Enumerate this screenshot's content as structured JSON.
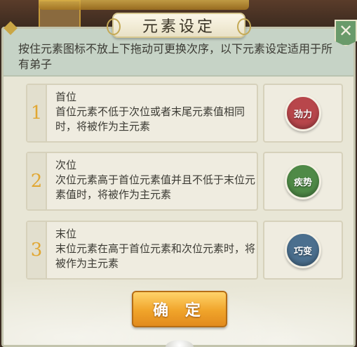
{
  "dialog": {
    "title": "元素设定",
    "description": "按住元素图标不放上下拖动可更换次序，以下元素设定适用于所有弟子",
    "close_icon": "close-icon",
    "confirm_label": "确 定"
  },
  "rows": [
    {
      "number": "1",
      "title": "首位",
      "desc": "首位元素不低于次位或者末尾元素值相同时，将被作为主元素",
      "element": {
        "label": "劲力",
        "color": "#b8464b",
        "icon": "element-jinli-icon"
      }
    },
    {
      "number": "2",
      "title": "次位",
      "desc": "次位元素高于首位元素值并且不低于末位元素值时，将被作为主元素",
      "element": {
        "label": "疾势",
        "color": "#4f8a47",
        "icon": "element-jishi-icon"
      }
    },
    {
      "number": "3",
      "title": "末位",
      "desc": "末位元素在高于首位元素和次位元素时，将被作为主元素",
      "element": {
        "label": "巧变",
        "color": "#4b6f8e",
        "icon": "element-qiaobian-icon"
      }
    }
  ],
  "colors": {
    "accent_gold": "#e1a733",
    "button_orange": "#f0a42a",
    "close_green": "#6a9a6a"
  }
}
